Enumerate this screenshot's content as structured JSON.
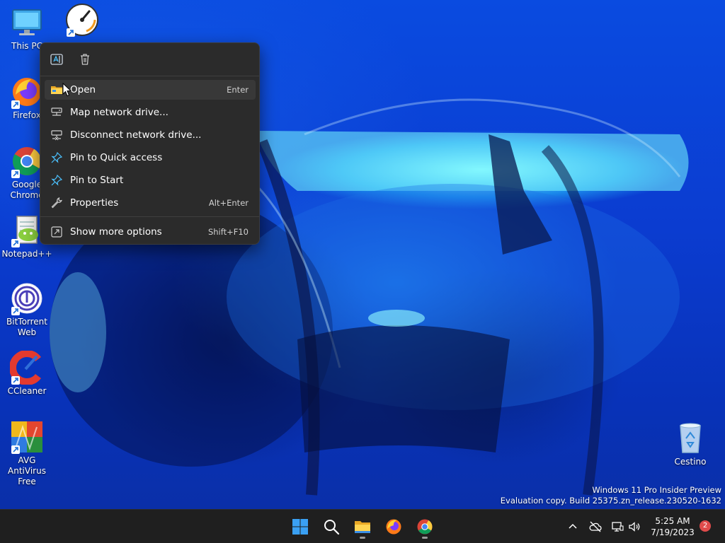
{
  "desktop": {
    "icons": [
      {
        "label": "This PC",
        "icon": "monitor-icon"
      },
      {
        "label": "",
        "icon": "clock-gauge-icon"
      },
      {
        "label": "Firefox",
        "icon": "firefox-icon"
      },
      {
        "label": "Google Chrome",
        "icon": "chrome-icon"
      },
      {
        "label": "Notepad++",
        "icon": "notepadpp-icon"
      },
      {
        "label": "BitTorrent Web",
        "icon": "bittorrent-icon"
      },
      {
        "label": "CCleaner",
        "icon": "ccleaner-icon"
      },
      {
        "label": "AVG AntiVirus Free",
        "icon": "avg-icon"
      },
      {
        "label": "Cestino",
        "icon": "recycle-bin-icon"
      }
    ]
  },
  "context_menu": {
    "top_actions": [
      {
        "name": "rename",
        "icon": "rename-icon"
      },
      {
        "name": "delete",
        "icon": "trash-icon"
      }
    ],
    "items": [
      {
        "label": "Open",
        "accelerator": "Enter",
        "icon": "folder-icon"
      },
      {
        "label": "Map network drive...",
        "accelerator": "",
        "icon": "network-drive-icon"
      },
      {
        "label": "Disconnect network drive...",
        "accelerator": "",
        "icon": "disconnect-drive-icon"
      },
      {
        "label": "Pin to Quick access",
        "accelerator": "",
        "icon": "pin-icon"
      },
      {
        "label": "Pin to Start",
        "accelerator": "",
        "icon": "pin-icon"
      },
      {
        "label": "Properties",
        "accelerator": "Alt+Enter",
        "icon": "wrench-icon"
      },
      {
        "label": "Show more options",
        "accelerator": "Shift+F10",
        "icon": "more-options-icon"
      }
    ],
    "hovered_item": "Open"
  },
  "watermark": {
    "line1": "Windows 11 Pro Insider Preview",
    "line2": "Evaluation copy. Build 25375.zn_release.230520-1632"
  },
  "taskbar": {
    "apps": [
      "start-icon",
      "search-icon",
      "file-explorer-icon",
      "firefox-icon",
      "chrome-icon"
    ],
    "clock_time": "5:25 AM",
    "clock_date": "7/19/2023",
    "notification_count": "2"
  },
  "colors": {
    "menu_bg": "#2b2b2b",
    "menu_hover": "#383838",
    "taskbar_bg": "#1f1f1f",
    "accent": "#4cc2ff",
    "badge": "#e04b4b"
  }
}
